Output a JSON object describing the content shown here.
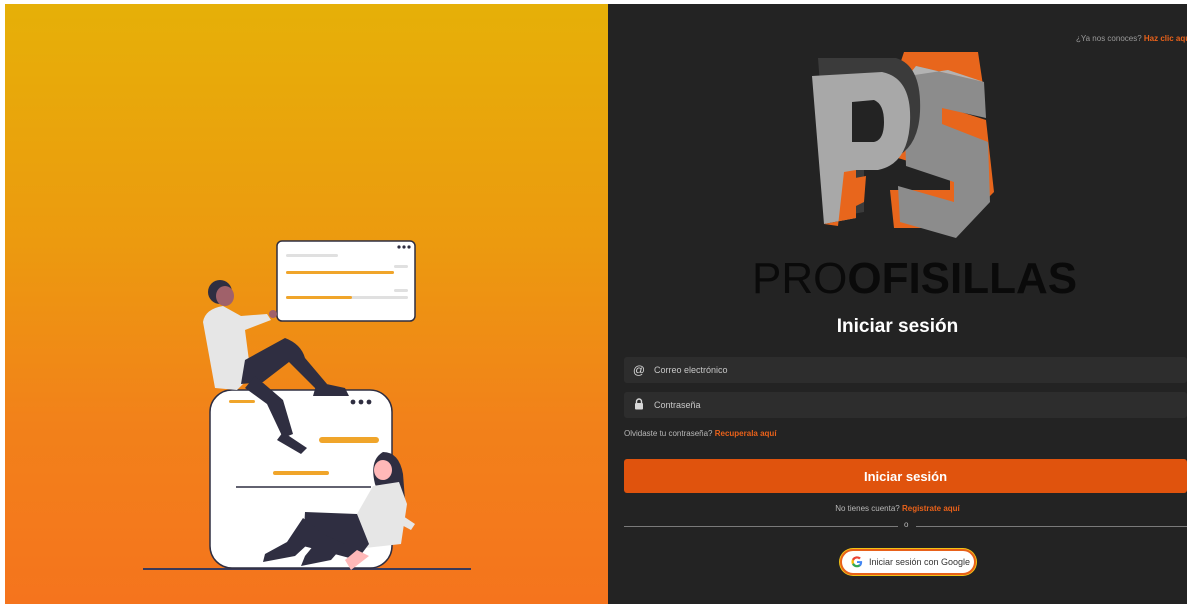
{
  "header": {
    "know_us_prefix": "¿Ya nos conoces?",
    "know_us_link": "Haz clic aquí"
  },
  "brand": {
    "logo_letters": "PS",
    "name_regular": "PRO",
    "name_bold": "OFISILLAS"
  },
  "login": {
    "title": "Iniciar sesión",
    "email_placeholder": "Correo electrónico",
    "password_placeholder": "Contraseña",
    "forgot_prefix": "Olvidaste tu contraseña?",
    "forgot_link": "Recuperala aquí",
    "submit_label": "Iniciar sesión",
    "register_prefix": "No tienes cuenta?",
    "register_link": "Registrate aquí",
    "divider_text": "o",
    "google_label": "Iniciar sesión con Google"
  },
  "icons": {
    "email": "at-sign-icon",
    "password": "lock-icon",
    "google": "google-icon"
  },
  "colors": {
    "accent": "#e0530d",
    "link": "#e8611a",
    "panel_bg": "#232323",
    "gradient_top": "#e6b008",
    "gradient_bottom": "#f5741d"
  }
}
